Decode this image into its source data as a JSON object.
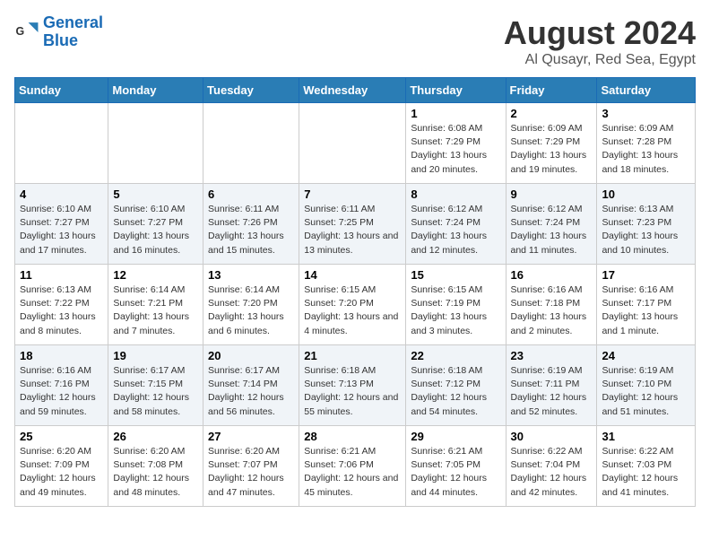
{
  "logo": {
    "line1": "General",
    "line2": "Blue"
  },
  "title": "August 2024",
  "location": "Al Qusayr, Red Sea, Egypt",
  "weekdays": [
    "Sunday",
    "Monday",
    "Tuesday",
    "Wednesday",
    "Thursday",
    "Friday",
    "Saturday"
  ],
  "weeks": [
    [
      {
        "day": "",
        "info": ""
      },
      {
        "day": "",
        "info": ""
      },
      {
        "day": "",
        "info": ""
      },
      {
        "day": "",
        "info": ""
      },
      {
        "day": "1",
        "info": "Sunrise: 6:08 AM\nSunset: 7:29 PM\nDaylight: 13 hours and 20 minutes."
      },
      {
        "day": "2",
        "info": "Sunrise: 6:09 AM\nSunset: 7:29 PM\nDaylight: 13 hours and 19 minutes."
      },
      {
        "day": "3",
        "info": "Sunrise: 6:09 AM\nSunset: 7:28 PM\nDaylight: 13 hours and 18 minutes."
      }
    ],
    [
      {
        "day": "4",
        "info": "Sunrise: 6:10 AM\nSunset: 7:27 PM\nDaylight: 13 hours and 17 minutes."
      },
      {
        "day": "5",
        "info": "Sunrise: 6:10 AM\nSunset: 7:27 PM\nDaylight: 13 hours and 16 minutes."
      },
      {
        "day": "6",
        "info": "Sunrise: 6:11 AM\nSunset: 7:26 PM\nDaylight: 13 hours and 15 minutes."
      },
      {
        "day": "7",
        "info": "Sunrise: 6:11 AM\nSunset: 7:25 PM\nDaylight: 13 hours and 13 minutes."
      },
      {
        "day": "8",
        "info": "Sunrise: 6:12 AM\nSunset: 7:24 PM\nDaylight: 13 hours and 12 minutes."
      },
      {
        "day": "9",
        "info": "Sunrise: 6:12 AM\nSunset: 7:24 PM\nDaylight: 13 hours and 11 minutes."
      },
      {
        "day": "10",
        "info": "Sunrise: 6:13 AM\nSunset: 7:23 PM\nDaylight: 13 hours and 10 minutes."
      }
    ],
    [
      {
        "day": "11",
        "info": "Sunrise: 6:13 AM\nSunset: 7:22 PM\nDaylight: 13 hours and 8 minutes."
      },
      {
        "day": "12",
        "info": "Sunrise: 6:14 AM\nSunset: 7:21 PM\nDaylight: 13 hours and 7 minutes."
      },
      {
        "day": "13",
        "info": "Sunrise: 6:14 AM\nSunset: 7:20 PM\nDaylight: 13 hours and 6 minutes."
      },
      {
        "day": "14",
        "info": "Sunrise: 6:15 AM\nSunset: 7:20 PM\nDaylight: 13 hours and 4 minutes."
      },
      {
        "day": "15",
        "info": "Sunrise: 6:15 AM\nSunset: 7:19 PM\nDaylight: 13 hours and 3 minutes."
      },
      {
        "day": "16",
        "info": "Sunrise: 6:16 AM\nSunset: 7:18 PM\nDaylight: 13 hours and 2 minutes."
      },
      {
        "day": "17",
        "info": "Sunrise: 6:16 AM\nSunset: 7:17 PM\nDaylight: 13 hours and 1 minute."
      }
    ],
    [
      {
        "day": "18",
        "info": "Sunrise: 6:16 AM\nSunset: 7:16 PM\nDaylight: 12 hours and 59 minutes."
      },
      {
        "day": "19",
        "info": "Sunrise: 6:17 AM\nSunset: 7:15 PM\nDaylight: 12 hours and 58 minutes."
      },
      {
        "day": "20",
        "info": "Sunrise: 6:17 AM\nSunset: 7:14 PM\nDaylight: 12 hours and 56 minutes."
      },
      {
        "day": "21",
        "info": "Sunrise: 6:18 AM\nSunset: 7:13 PM\nDaylight: 12 hours and 55 minutes."
      },
      {
        "day": "22",
        "info": "Sunrise: 6:18 AM\nSunset: 7:12 PM\nDaylight: 12 hours and 54 minutes."
      },
      {
        "day": "23",
        "info": "Sunrise: 6:19 AM\nSunset: 7:11 PM\nDaylight: 12 hours and 52 minutes."
      },
      {
        "day": "24",
        "info": "Sunrise: 6:19 AM\nSunset: 7:10 PM\nDaylight: 12 hours and 51 minutes."
      }
    ],
    [
      {
        "day": "25",
        "info": "Sunrise: 6:20 AM\nSunset: 7:09 PM\nDaylight: 12 hours and 49 minutes."
      },
      {
        "day": "26",
        "info": "Sunrise: 6:20 AM\nSunset: 7:08 PM\nDaylight: 12 hours and 48 minutes."
      },
      {
        "day": "27",
        "info": "Sunrise: 6:20 AM\nSunset: 7:07 PM\nDaylight: 12 hours and 47 minutes."
      },
      {
        "day": "28",
        "info": "Sunrise: 6:21 AM\nSunset: 7:06 PM\nDaylight: 12 hours and 45 minutes."
      },
      {
        "day": "29",
        "info": "Sunrise: 6:21 AM\nSunset: 7:05 PM\nDaylight: 12 hours and 44 minutes."
      },
      {
        "day": "30",
        "info": "Sunrise: 6:22 AM\nSunset: 7:04 PM\nDaylight: 12 hours and 42 minutes."
      },
      {
        "day": "31",
        "info": "Sunrise: 6:22 AM\nSunset: 7:03 PM\nDaylight: 12 hours and 41 minutes."
      }
    ]
  ]
}
